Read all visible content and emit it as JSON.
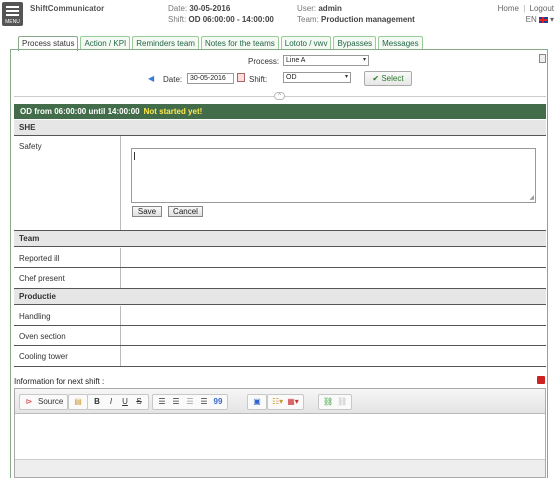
{
  "header": {
    "menu_label": "MENU",
    "app_title": "ShiftCommunicator",
    "date_label": "Date:",
    "date_value": "30-05-2016",
    "shift_label": "Shift:",
    "shift_value": "OD  06:00:00 - 14:00:00",
    "user_label": "User:",
    "user_value": "admin",
    "team_label": "Team:",
    "team_value": "Production management",
    "home_link": "Home",
    "logout_link": "Logout",
    "language": "EN",
    "separator": "|"
  },
  "tabs": [
    {
      "label": "Process status",
      "active": true
    },
    {
      "label": "Action / KPI"
    },
    {
      "label": "Reminders team"
    },
    {
      "label": "Notes for the teams"
    },
    {
      "label": "Lototo / vwv"
    },
    {
      "label": "Bypasses"
    },
    {
      "label": "Messages"
    }
  ],
  "filters": {
    "process_label": "Process:",
    "process_value": "Line A",
    "date_label": "Date:",
    "date_value": "30-05-2016",
    "shift_label": "Shift:",
    "shift_value": "OD",
    "select_button": "Select"
  },
  "banner": {
    "text": "OD from 06:00:00 until 14:00:00",
    "status": "Not started yet!"
  },
  "sections": {
    "she": "SHE",
    "team": "Team",
    "productie": "Productie"
  },
  "rows": {
    "safety": "Safety",
    "reported_ill": "Reported ill",
    "chef_present": "Chef present",
    "handling": "Handling",
    "oven_section": "Oven section",
    "cooling_tower": "Cooling tower"
  },
  "safety_editor": {
    "value": "",
    "save_button": "Save",
    "cancel_button": "Cancel"
  },
  "next_shift": {
    "label": "Information for next shift :"
  },
  "editor_toolbar": {
    "source": "Source",
    "bold": "B",
    "italic": "I",
    "underline": "U",
    "strike": "S",
    "quote": "99"
  },
  "colors": {
    "banner_bg": "#436d4a",
    "banner_status": "#ffe94d",
    "tab_border": "#99cc99"
  }
}
